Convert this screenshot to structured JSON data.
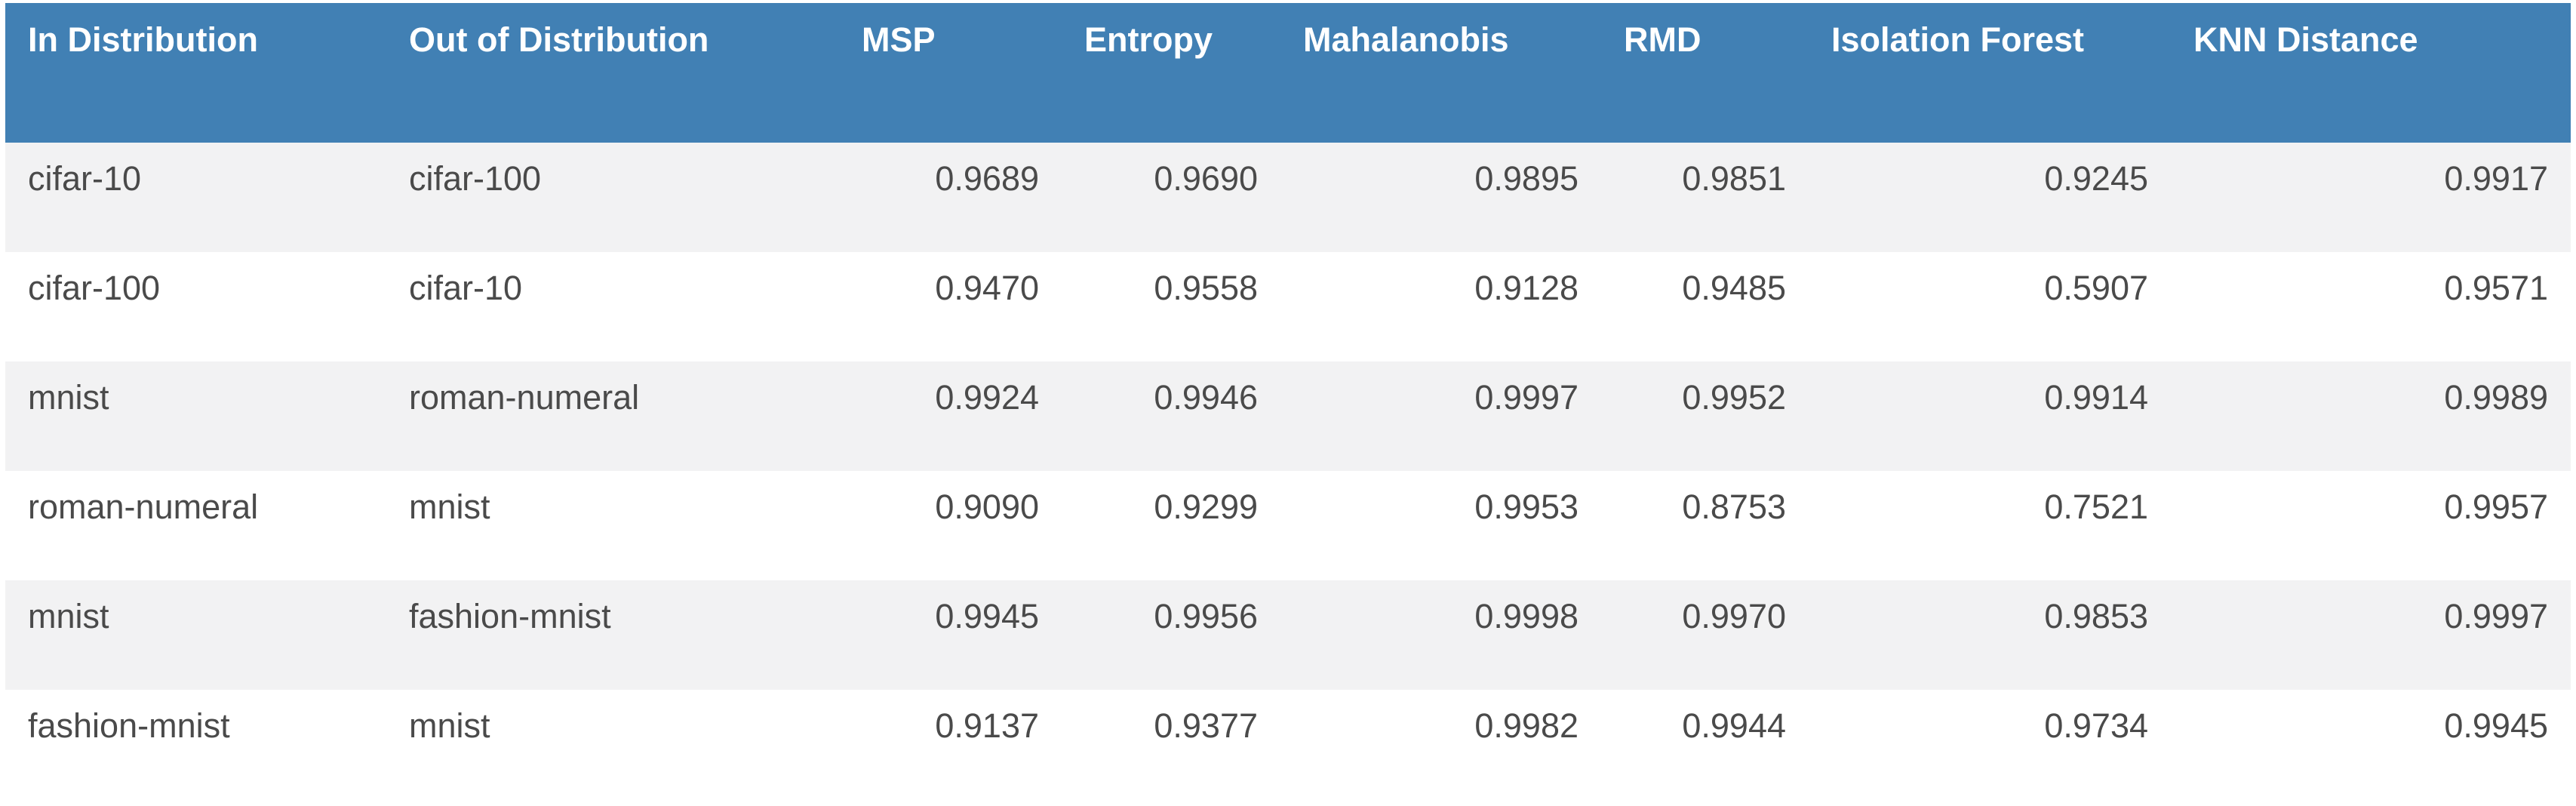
{
  "table": {
    "columns": [
      {
        "label": "In Distribution",
        "type": "text",
        "key": "in_distribution"
      },
      {
        "label": "Out of Distribution",
        "type": "text",
        "key": "out_distribution"
      },
      {
        "label": "MSP",
        "type": "number",
        "key": "msp"
      },
      {
        "label": "Entropy",
        "type": "number",
        "key": "entropy"
      },
      {
        "label": "Mahalanobis",
        "type": "number",
        "key": "mahalanobis"
      },
      {
        "label": "RMD",
        "type": "number",
        "key": "rmd"
      },
      {
        "label": "Isolation Forest",
        "type": "number",
        "key": "isolation_forest"
      },
      {
        "label": "KNN Distance",
        "type": "number",
        "key": "knn_distance"
      }
    ],
    "header_bg": "#4180b4",
    "header_fg": "#ffffff",
    "row_odd_bg": "#f2f2f3",
    "row_even_bg": "#ffffff",
    "cell_fg": "#4a4a4a",
    "rows": [
      {
        "in_distribution": "cifar-10",
        "out_distribution": "cifar-100",
        "msp": "0.9689",
        "entropy": "0.9690",
        "mahalanobis": "0.9895",
        "rmd": "0.9851",
        "isolation_forest": "0.9245",
        "knn_distance": "0.9917"
      },
      {
        "in_distribution": "cifar-100",
        "out_distribution": "cifar-10",
        "msp": "0.9470",
        "entropy": "0.9558",
        "mahalanobis": "0.9128",
        "rmd": "0.9485",
        "isolation_forest": "0.5907",
        "knn_distance": "0.9571"
      },
      {
        "in_distribution": "mnist",
        "out_distribution": "roman-numeral",
        "msp": "0.9924",
        "entropy": "0.9946",
        "mahalanobis": "0.9997",
        "rmd": "0.9952",
        "isolation_forest": "0.9914",
        "knn_distance": "0.9989"
      },
      {
        "in_distribution": "roman-numeral",
        "out_distribution": "mnist",
        "msp": "0.9090",
        "entropy": "0.9299",
        "mahalanobis": "0.9953",
        "rmd": "0.8753",
        "isolation_forest": "0.7521",
        "knn_distance": "0.9957"
      },
      {
        "in_distribution": "mnist",
        "out_distribution": "fashion-mnist",
        "msp": "0.9945",
        "entropy": "0.9956",
        "mahalanobis": "0.9998",
        "rmd": "0.9970",
        "isolation_forest": "0.9853",
        "knn_distance": "0.9997"
      },
      {
        "in_distribution": "fashion-mnist",
        "out_distribution": "mnist",
        "msp": "0.9137",
        "entropy": "0.9377",
        "mahalanobis": "0.9982",
        "rmd": "0.9944",
        "isolation_forest": "0.9734",
        "knn_distance": "0.9945"
      }
    ]
  },
  "chart_data": {
    "type": "table",
    "title": "",
    "columns": [
      "In Distribution",
      "Out of Distribution",
      "MSP",
      "Entropy",
      "Mahalanobis",
      "RMD",
      "Isolation Forest",
      "KNN Distance"
    ],
    "rows": [
      [
        "cifar-10",
        "cifar-100",
        0.9689,
        0.969,
        0.9895,
        0.9851,
        0.9245,
        0.9917
      ],
      [
        "cifar-100",
        "cifar-10",
        0.947,
        0.9558,
        0.9128,
        0.9485,
        0.5907,
        0.9571
      ],
      [
        "mnist",
        "roman-numeral",
        0.9924,
        0.9946,
        0.9997,
        0.9952,
        0.9914,
        0.9989
      ],
      [
        "roman-numeral",
        "mnist",
        0.909,
        0.9299,
        0.9953,
        0.8753,
        0.7521,
        0.9957
      ],
      [
        "mnist",
        "fashion-mnist",
        0.9945,
        0.9956,
        0.9998,
        0.997,
        0.9853,
        0.9997
      ],
      [
        "fashion-mnist",
        "mnist",
        0.9137,
        0.9377,
        0.9982,
        0.9944,
        0.9734,
        0.9945
      ]
    ]
  }
}
